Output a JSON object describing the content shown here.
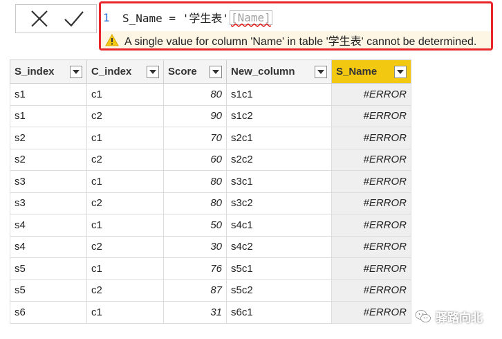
{
  "formula": {
    "line_number": "1",
    "text": "S_Name = '学生表'",
    "ref": "[Name]",
    "error_message": "A single value for column 'Name' in table '学生表' cannot be determined."
  },
  "table": {
    "columns": [
      {
        "label": "S_index"
      },
      {
        "label": "C_index"
      },
      {
        "label": "Score"
      },
      {
        "label": "New_column"
      },
      {
        "label": "S_Name"
      }
    ],
    "rows": [
      [
        "s1",
        "c1",
        "80",
        "s1c1",
        "#ERROR"
      ],
      [
        "s1",
        "c2",
        "90",
        "s1c2",
        "#ERROR"
      ],
      [
        "s2",
        "c1",
        "70",
        "s2c1",
        "#ERROR"
      ],
      [
        "s2",
        "c2",
        "60",
        "s2c2",
        "#ERROR"
      ],
      [
        "s3",
        "c1",
        "80",
        "s3c1",
        "#ERROR"
      ],
      [
        "s3",
        "c2",
        "80",
        "s3c2",
        "#ERROR"
      ],
      [
        "s4",
        "c1",
        "50",
        "s4c1",
        "#ERROR"
      ],
      [
        "s4",
        "c2",
        "30",
        "s4c2",
        "#ERROR"
      ],
      [
        "s5",
        "c1",
        "76",
        "s5c1",
        "#ERROR"
      ],
      [
        "s5",
        "c2",
        "87",
        "s5c2",
        "#ERROR"
      ],
      [
        "s6",
        "c1",
        "31",
        "s6c1",
        "#ERROR"
      ]
    ]
  },
  "watermark": {
    "text": "驿路向北"
  },
  "colors": {
    "error_border": "#e8262a",
    "active_header": "#f2c811",
    "warning_icon": "#f2c811"
  }
}
